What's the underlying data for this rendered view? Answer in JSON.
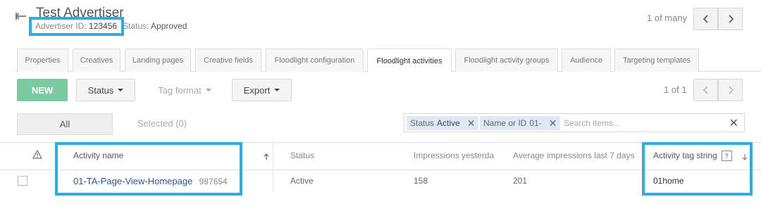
{
  "header": {
    "title": "Test Advertiser",
    "advertiser_id_label": "Advertiser ID:",
    "advertiser_id_value": "123456",
    "status_label": "Status:",
    "status_value": "Approved",
    "pager_text": "1 of many"
  },
  "tabs": [
    {
      "label": "Properties"
    },
    {
      "label": "Creatives"
    },
    {
      "label": "Landing pages"
    },
    {
      "label": "Creative fields"
    },
    {
      "label": "Floodlight configuration"
    },
    {
      "label": "Floodlight activities",
      "active": true
    },
    {
      "label": "Floodlight activity groups"
    },
    {
      "label": "Audience"
    },
    {
      "label": "Targeting templates"
    }
  ],
  "toolbar": {
    "new_label": "NEW",
    "status_label": "Status",
    "tag_format_label": "Tag format",
    "export_label": "Export",
    "pager_text": "1 of 1"
  },
  "filters": {
    "all_label": "All",
    "selected_label": "Selected (0)",
    "chip1_key": "Status",
    "chip1_value": "Active",
    "chip2_key": "Name or ID",
    "chip2_value": "01-",
    "search_placeholder": "Search items..."
  },
  "table": {
    "columns": {
      "activity_name": "Activity name",
      "status": "Status",
      "impressions_yesterday": "Impressions yesterda",
      "avg_impressions": "Average impressions last 7 days",
      "activity_tag_string": "Activity tag string",
      "help": "?"
    },
    "rows": [
      {
        "name": "01-TA-Page-View-Homepage",
        "id": "987654",
        "status": "Active",
        "impressions_yesterday": "158",
        "avg_impressions": "201",
        "tag_string": "01home"
      }
    ]
  },
  "colors": {
    "accent_highlight": "#29aee5",
    "new_button": "#7ccaa0",
    "link": "#2a56a8"
  },
  "icons": [
    "back-arrow-icon",
    "chevron-left-icon",
    "chevron-right-icon",
    "caret-down-icon",
    "close-icon",
    "warning-icon",
    "sort-arrow-icon",
    "help-icon"
  ]
}
